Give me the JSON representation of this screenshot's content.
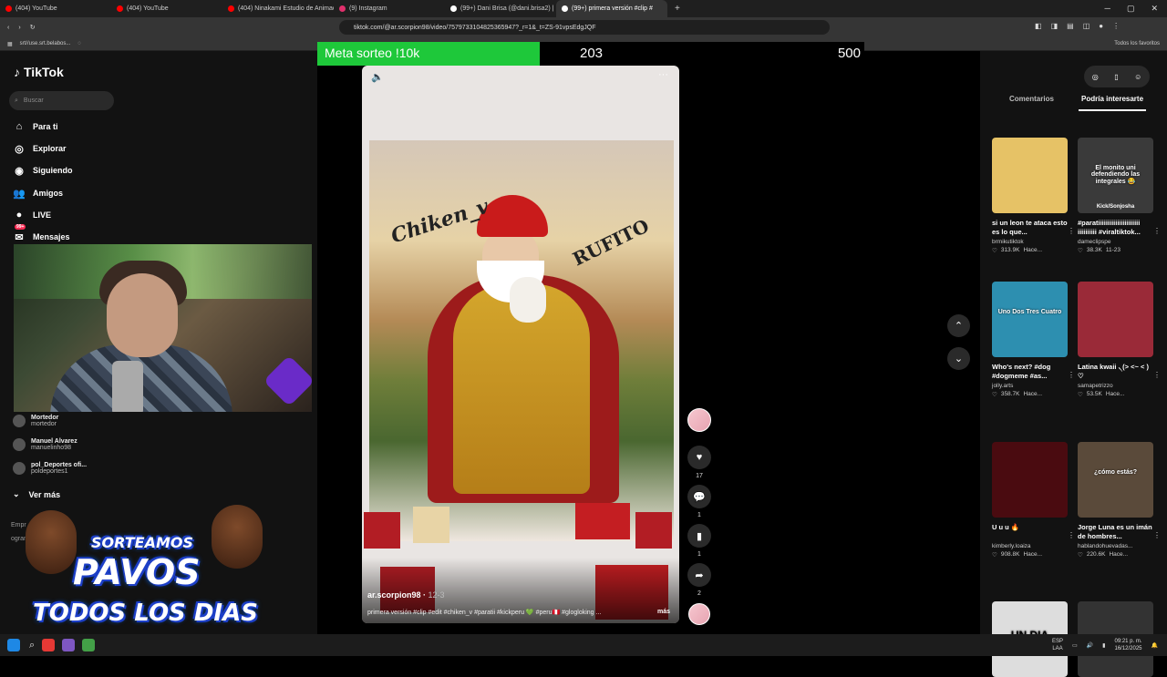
{
  "browser": {
    "tabs": [
      {
        "label": "(404) YouTube",
        "color": "#ff0000"
      },
      {
        "label": "(404) YouTube",
        "color": "#ff0000"
      },
      {
        "label": "(404) Ninakami Estudio de Animació",
        "color": "#ff0000"
      },
      {
        "label": "(9) Instagram",
        "color": "#e1306c"
      },
      {
        "label": "(99+) Dani Brisa (@dani.brisa2) |",
        "color": "#ffffff"
      },
      {
        "label": "(99+) primera versión #clip #",
        "color": "#ffffff"
      }
    ],
    "new_tab": "+",
    "address_url": "tiktok.com/@ar.scorpion98/video/7579733104825365947?_r=1&_t=ZS-91vpsEdgJQF",
    "bookmark_item": "srt//use.srt.belabos...",
    "bookmarks_right": "Todos los favoritos"
  },
  "tiktok": {
    "logo": "TikTok",
    "search_placeholder": "Buscar",
    "nav": [
      {
        "label": "Para ti",
        "icon": "home-icon",
        "glyph": "⌂"
      },
      {
        "label": "Explorar",
        "icon": "compass-icon",
        "glyph": "◎"
      },
      {
        "label": "Siguiendo",
        "icon": "following-icon",
        "glyph": "◉"
      },
      {
        "label": "Amigos",
        "icon": "friends-icon",
        "glyph": "👥"
      },
      {
        "label": "LIVE",
        "icon": "live-icon",
        "glyph": "●"
      },
      {
        "label": "Mensajes",
        "icon": "messages-icon",
        "glyph": "✉",
        "badge": "99+"
      }
    ],
    "following": [
      {
        "name": "Mortedor",
        "handle": "mortedor"
      },
      {
        "name": "Manuel Alvarez",
        "handle": "manuelinho98",
        "verified": true
      },
      {
        "name": "pol_Deportes ofi...",
        "handle": "poldeportes1"
      }
    ],
    "see_more": "Ver más",
    "footer_partial": [
      "Empr",
      "ograma"
    ]
  },
  "meta": {
    "label": "Meta sorteo !10k",
    "current": "203",
    "max": "500",
    "progress": 0.406,
    "fill_color": "#1ec83a"
  },
  "video": {
    "author": "ar.scorpion98",
    "date": "12-3",
    "description": "primera versión #clip #edit #chiken_v #paratii #kickperu 💚 #peru🇵🇪 #glogloking ...",
    "more": "más",
    "overlay_text_1": "Chiken_v",
    "overlay_text_2": "RUFITO"
  },
  "actions": {
    "likes": "17",
    "comments": "1",
    "saves": "1",
    "shares": "2"
  },
  "right_panel": {
    "tabs": [
      "Comentarios",
      "Podría interesarte"
    ],
    "active_tab": 1,
    "cards": [
      {
        "title": "si un leon te ataca esto es lo que...",
        "author": "brmikutiktok",
        "views": "313.9K",
        "time": "Hace...",
        "thumb": "#e6c266"
      },
      {
        "title": "#paratiiiiiiiiiiiiiiiiiiiiii iiiiiiiiii #viraltiktok...",
        "author": "dameclipspe",
        "views": "38.3K",
        "time": "11-23",
        "thumb": "#3a3a3a",
        "overlay": "El monito uni defendiendo las integrales 😂",
        "tag": "Kick/Sonjosha"
      },
      {
        "title": "Who's next? #dog #dogmeme #as...",
        "author": "jolly.arts",
        "views": "358.7K",
        "time": "Hace...",
        "thumb": "#2d8fb0",
        "overlay": "Uno Dos Tres Cuatro"
      },
      {
        "title": "Latina kwaii ৲(˃ ˂~ < ) ♡",
        "author": "samapetrizzo",
        "views": "53.5K",
        "time": "Hace...",
        "thumb": "#9a2a38"
      },
      {
        "title": "U u u 🔥",
        "author": "kimberly.loaiza",
        "views": "908.8K",
        "time": "Hace...",
        "thumb": "#4a0b10",
        "verified": true
      },
      {
        "title": "Jorge Luna es un imán de hombres...",
        "author": "hablandohuevadas...",
        "views": "220.6K",
        "time": "Hace...",
        "thumb": "#5a4a3a",
        "overlay": "¿cómo estás?",
        "verified": true
      },
      {
        "title": "",
        "author": "",
        "views": "",
        "time": "",
        "thumb": "#ddd",
        "overlay": "UN DIA COMO"
      },
      {
        "title": "",
        "author": "",
        "views": "",
        "time": "",
        "thumb": "#333"
      }
    ]
  },
  "promo": {
    "line1": "SORTEAMOS",
    "line2": "PAVOS",
    "line3": "TODOS LOS DIAS"
  },
  "taskbar": {
    "lang_top": "ESP",
    "lang_bottom": "LAA",
    "time": "09:21 p. m.",
    "date": "16/12/2025"
  }
}
